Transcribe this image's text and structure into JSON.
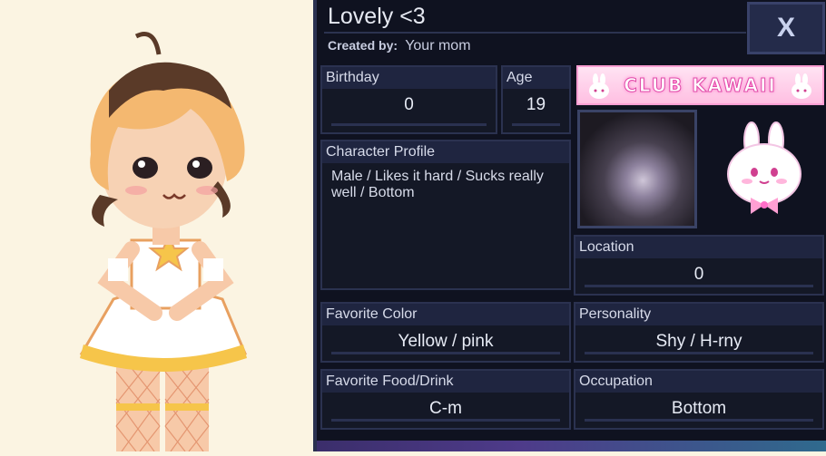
{
  "profile": {
    "name": "Lovely <3",
    "created_by_label": "Created by:",
    "created_by_value": "Your mom",
    "close_label": "X"
  },
  "fields": {
    "birthday": {
      "label": "Birthday",
      "value": "0"
    },
    "age": {
      "label": "Age",
      "value": "19"
    },
    "character_profile": {
      "label": "Character Profile",
      "value": "Male / Likes it hard / Sucks really well / Bottom"
    },
    "location": {
      "label": "Location",
      "value": "0"
    },
    "favorite_color": {
      "label": "Favorite Color",
      "value": "Yellow / pink"
    },
    "personality": {
      "label": "Personality",
      "value": "Shy / H-rny"
    },
    "favorite_food": {
      "label": "Favorite Food/Drink",
      "value": "C-m"
    },
    "occupation": {
      "label": "Occupation",
      "value": "Bottom"
    }
  },
  "banner": {
    "text": "CLUB KAWAII"
  },
  "colors": {
    "panel": "#0f1220",
    "field_border": "#2b3250",
    "accent_pink": "#ff9fd3",
    "background": "#fbf4e2"
  }
}
